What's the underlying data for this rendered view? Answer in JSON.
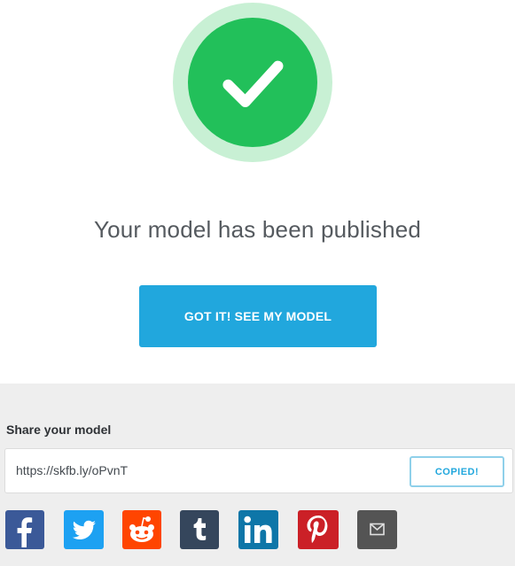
{
  "status": {
    "icon": "check-icon",
    "message": "Your model has been published"
  },
  "primary_action": {
    "label": "GOT IT! SEE MY MODEL"
  },
  "share": {
    "title": "Share your model",
    "url": "https://skfb.ly/oPvnT",
    "copy_label": "COPIED!",
    "networks": [
      {
        "icon": "facebook-icon",
        "color": "#3b5998"
      },
      {
        "icon": "twitter-icon",
        "color": "#1da1f2"
      },
      {
        "icon": "reddit-icon",
        "color": "#ff4500"
      },
      {
        "icon": "tumblr-icon",
        "color": "#35465c"
      },
      {
        "icon": "linkedin-icon",
        "color": "#0e76a8"
      },
      {
        "icon": "pinterest-icon",
        "color": "#cb2027"
      },
      {
        "icon": "email-icon",
        "color": "#545454"
      }
    ]
  },
  "colors": {
    "success_green": "#22c05a",
    "success_halo": "#c8f0d4",
    "accent_blue": "#21a7dd",
    "panel_gray": "#eeeeee"
  }
}
